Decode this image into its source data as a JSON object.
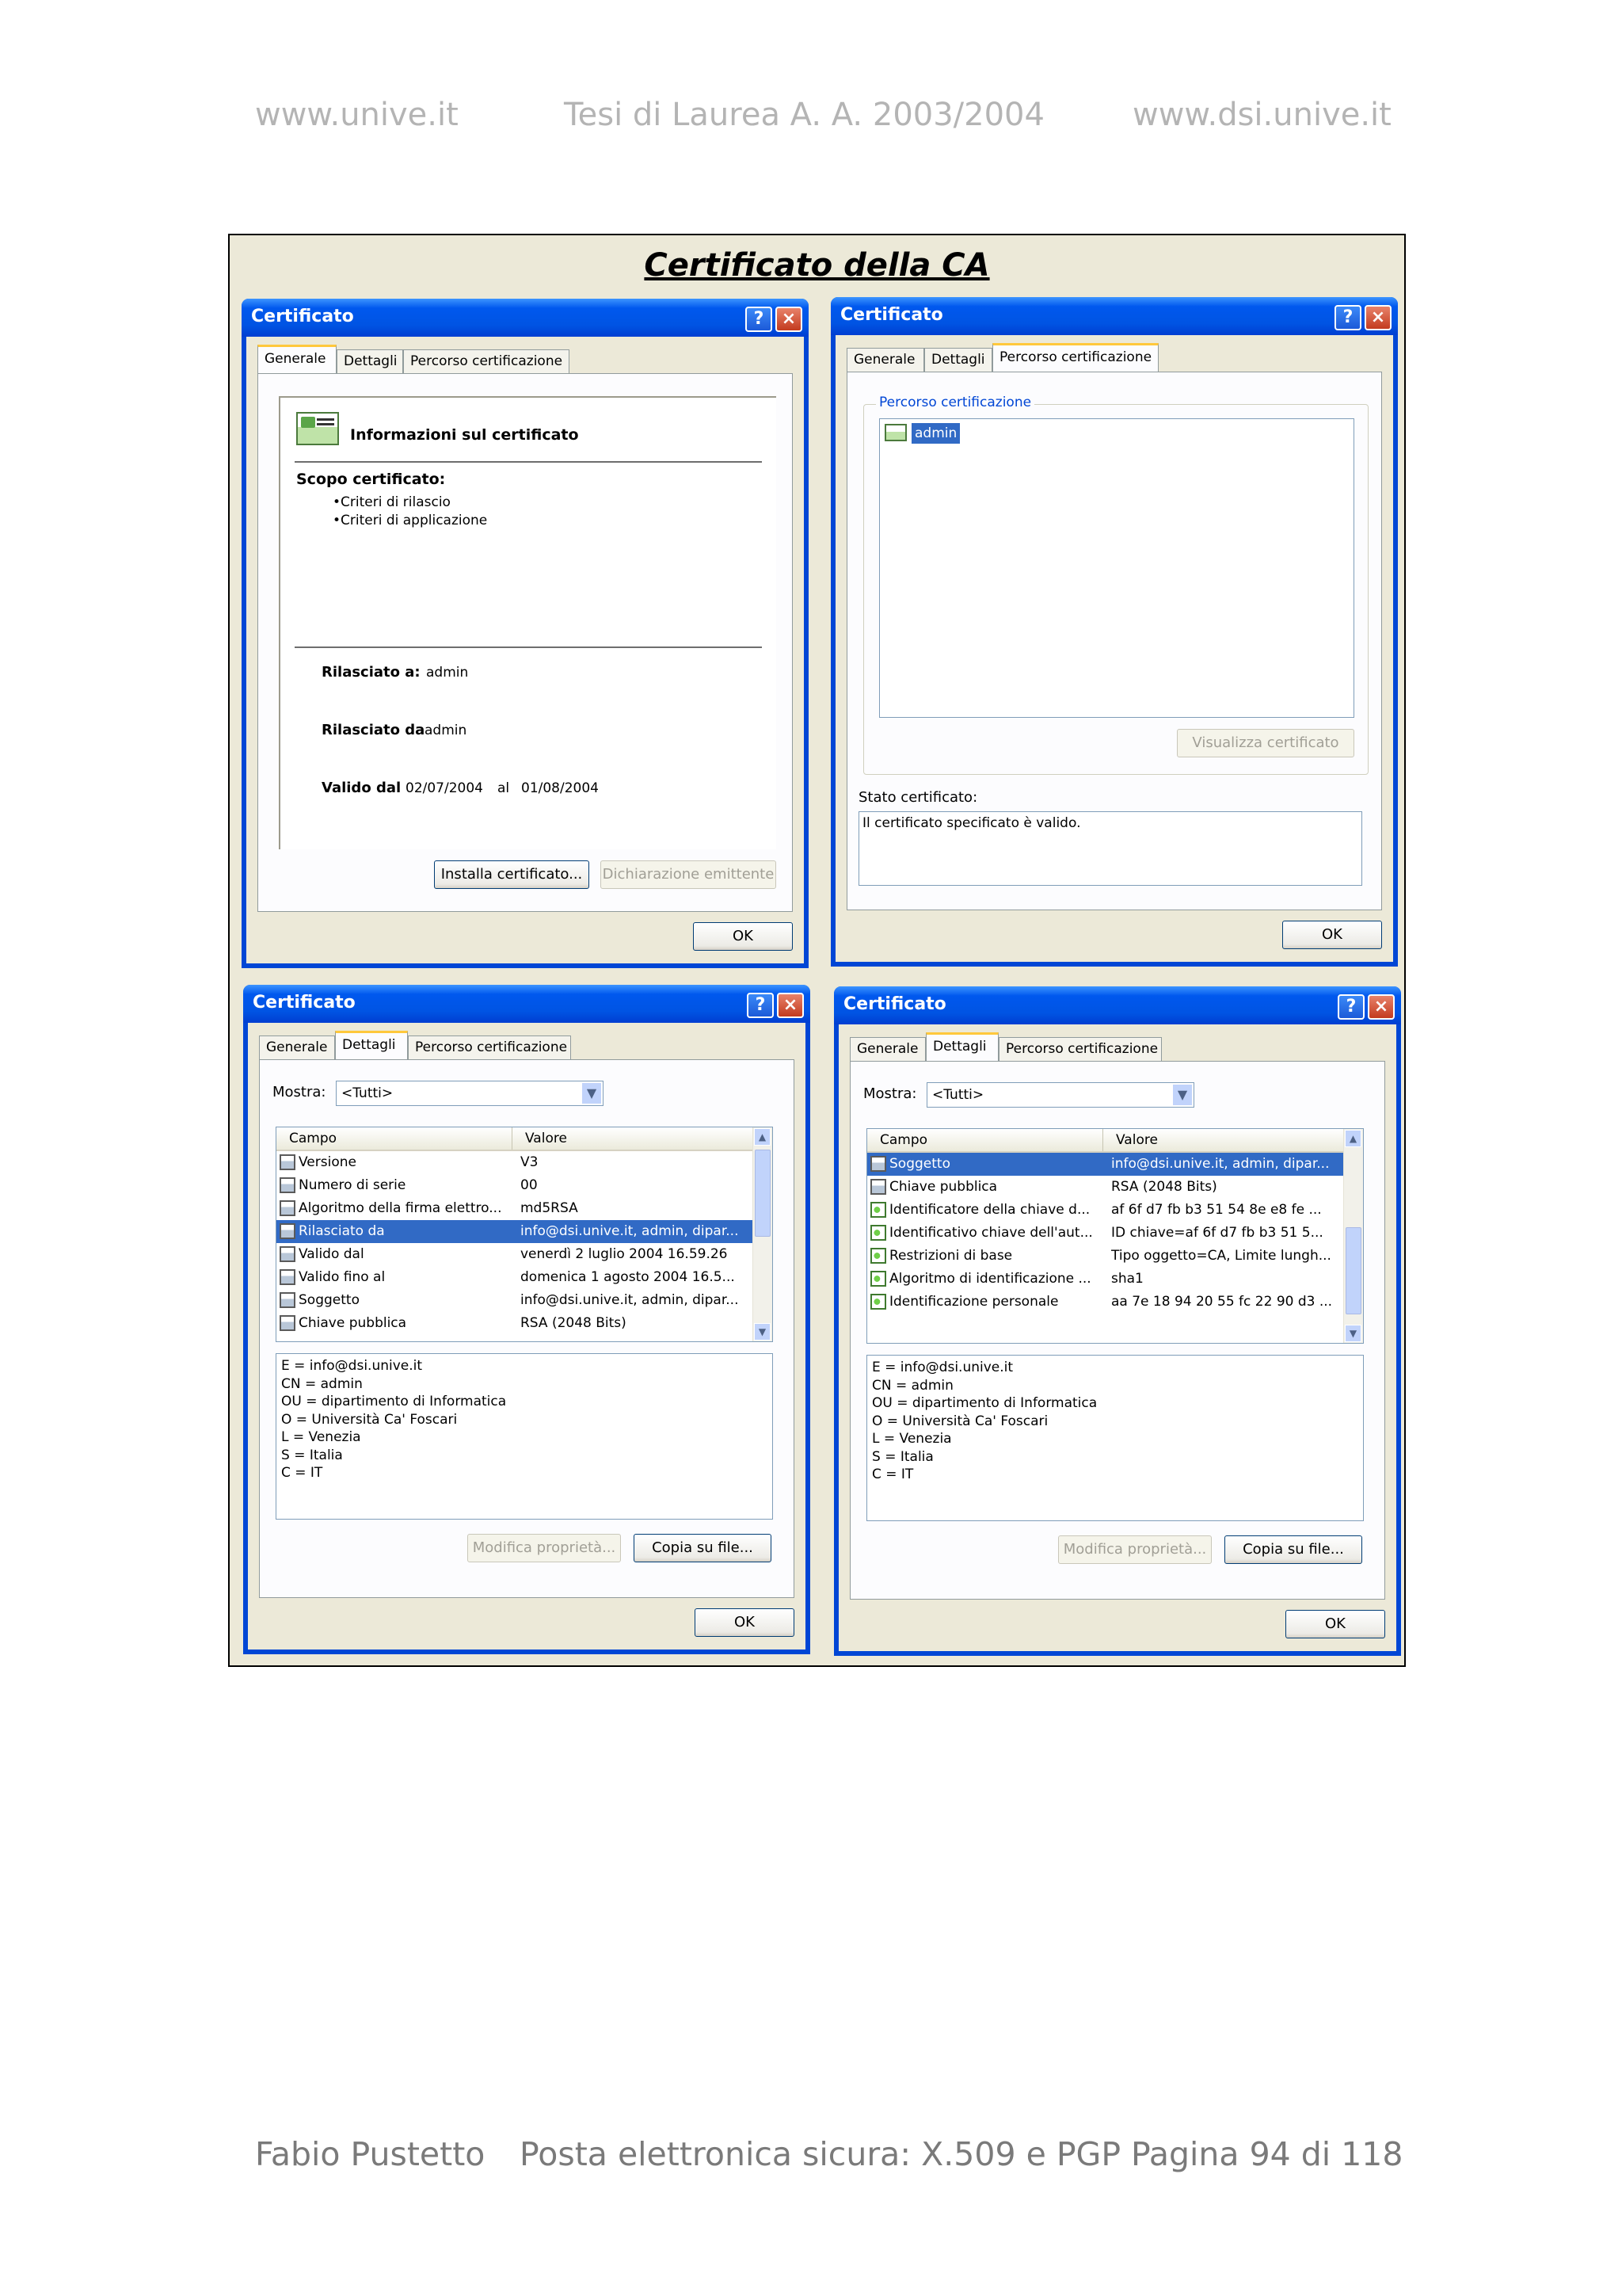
{
  "page_header": {
    "left": "www.unive.it",
    "center": "Tesi di Laurea A. A. 2003/2004",
    "right": "www.dsi.unive.it"
  },
  "page_footer": {
    "author": "Fabio Pustetto",
    "title": "Posta elettronica sicura: X.509 e PGP",
    "page": "Pagina 94 di 118"
  },
  "figure": {
    "title": "Certificato della CA",
    "dialog_title": "Certificato",
    "title_buttons": {
      "help": "?",
      "close": "×"
    },
    "tabs": [
      "Generale",
      "Dettagli",
      "Percorso certificazione"
    ],
    "ok_label": "OK",
    "general": {
      "info_heading": "Informazioni sul certificato",
      "purpose_label": "Scopo certificato:",
      "purposes": [
        "•Criteri di rilascio",
        "•Criteri di applicazione"
      ],
      "issued_to_label": "Rilasciato a:",
      "issued_to": "admin",
      "issued_by_label": "Rilasciato da",
      "issued_by": "admin",
      "valid_from_label": "Valido dal",
      "valid_from": "02/07/2004",
      "valid_to_label": "al",
      "valid_to": "01/08/2004",
      "install_button": "Installa certificato...",
      "issuer_statement_button": "Dichiarazione emittente"
    },
    "path": {
      "group_label": "Percorso certificazione",
      "node": "admin",
      "view_button": "Visualizza certificato",
      "status_label": "Stato certificato:",
      "status_text": "Il certificato specificato è valido."
    },
    "details_common": {
      "show_label": "Mostra:",
      "show_value": "<Tutti>",
      "col_field": "Campo",
      "col_value": "Valore",
      "edit_button": "Modifica proprietà...",
      "copy_button": "Copia su file..."
    },
    "details_left": {
      "rows": [
        {
          "field": "Versione",
          "value": "V3",
          "icon": "doc",
          "selected": false
        },
        {
          "field": "Numero di serie",
          "value": "00",
          "icon": "doc",
          "selected": false
        },
        {
          "field": "Algoritmo della firma elettro...",
          "value": "md5RSA",
          "icon": "doc",
          "selected": false
        },
        {
          "field": "Rilasciato da",
          "value": "info@dsi.unive.it, admin, dipar...",
          "icon": "doc",
          "selected": true
        },
        {
          "field": "Valido dal",
          "value": "venerdì 2 luglio 2004 16.59.26",
          "icon": "doc",
          "selected": false
        },
        {
          "field": "Valido fino al",
          "value": "domenica 1 agosto 2004 16.5...",
          "icon": "doc",
          "selected": false
        },
        {
          "field": "Soggetto",
          "value": "info@dsi.unive.it, admin, dipar...",
          "icon": "doc",
          "selected": false
        },
        {
          "field": "Chiave pubblica",
          "value": "RSA (2048 Bits)",
          "icon": "doc",
          "selected": false
        }
      ],
      "detail_lines": [
        "E = info@dsi.unive.it",
        "CN = admin",
        "OU = dipartimento di Informatica",
        "O = Università Ca' Foscari",
        "L = Venezia",
        "S = Italia",
        "C = IT"
      ]
    },
    "details_right": {
      "rows": [
        {
          "field": "Soggetto",
          "value": "info@dsi.unive.it, admin, dipar...",
          "icon": "doc",
          "selected": true
        },
        {
          "field": "Chiave pubblica",
          "value": "RSA (2048 Bits)",
          "icon": "doc",
          "selected": false
        },
        {
          "field": "Identificatore della chiave d...",
          "value": "af 6f d7 fb b3 51 54 8e e8 fe ...",
          "icon": "ext",
          "selected": false
        },
        {
          "field": "Identificativo chiave dell'aut...",
          "value": "ID chiave=af 6f d7 fb b3 51 5...",
          "icon": "ext",
          "selected": false
        },
        {
          "field": "Restrizioni di base",
          "value": "Tipo oggetto=CA, Limite lungh...",
          "icon": "ext",
          "selected": false
        },
        {
          "field": "Algoritmo di identificazione ...",
          "value": "sha1",
          "icon": "ext",
          "selected": false
        },
        {
          "field": "Identificazione personale",
          "value": "aa 7e 18 94 20 55 fc 22 90 d3 ...",
          "icon": "ext",
          "selected": false
        }
      ],
      "detail_lines": [
        "E = info@dsi.unive.it",
        "CN = admin",
        "OU = dipartimento di Informatica",
        "O = Università Ca' Foscari",
        "L = Venezia",
        "S = Italia",
        "C = IT"
      ]
    }
  }
}
